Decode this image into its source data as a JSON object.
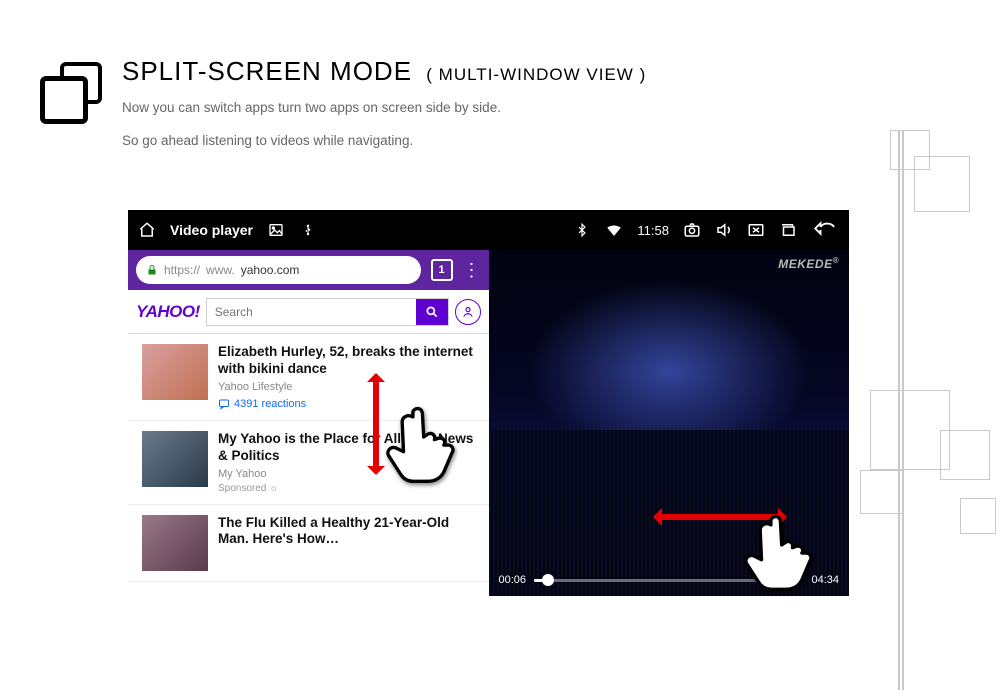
{
  "header": {
    "title": "SPLIT-SCREEN MODE",
    "subtitle": "( MULTI-WINDOW VIEW )",
    "line1": "Now you can switch apps turn two apps on screen side by side.",
    "line2": "So go ahead listening to videos while navigating."
  },
  "statusbar": {
    "app_title": "Video player",
    "time": "11:58"
  },
  "browser": {
    "url_prefix": "https://",
    "url_host": "www.",
    "url_main": "yahoo.com",
    "tab_count": "1",
    "search_placeholder": "Search"
  },
  "feed": [
    {
      "title": "Elizabeth Hurley, 52, breaks the internet with bikini dance",
      "source": "Yahoo Lifestyle",
      "reactions": "4391 reactions",
      "sponsored": false
    },
    {
      "title": "My Yahoo is the Place for All Your News & Politics",
      "source": "My Yahoo",
      "reactions": "",
      "sponsored": true
    },
    {
      "title": "The Flu Killed a Healthy 21-Year-Old Man. Here's How…",
      "source": "",
      "reactions": "",
      "sponsored": false
    }
  ],
  "video": {
    "brand": "MEKEDE",
    "elapsed": "00:06",
    "total": "04:34"
  }
}
